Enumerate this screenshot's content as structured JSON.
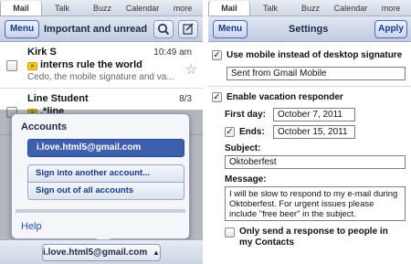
{
  "tabs": [
    "Mail",
    "Talk",
    "Buzz",
    "Calendar",
    "more"
  ],
  "left": {
    "menu_label": "Menu",
    "title": "Important and unread",
    "emails": [
      {
        "from": "Kirk S",
        "date": "10:49 am",
        "subject": "interns rule the world",
        "snippet": "Cedo, the mobile signature and va..."
      },
      {
        "from": "Line Student",
        "date": "8/3",
        "subject": ".*line",
        "snippet": ""
      }
    ],
    "popup": {
      "title": "Accounts",
      "current_account": "i.love.html5@gmail.com",
      "sign_in_other": "Sign into another account...",
      "sign_out_all": "Sign out of all accounts",
      "help": "Help"
    },
    "footer_account": "i.love.html5@gmail.com"
  },
  "right": {
    "menu_label": "Menu",
    "title": "Settings",
    "apply_label": "Apply",
    "use_mobile_signature_label": "Use mobile instead of desktop signature",
    "signature_value": "Sent from Gmail Mobile",
    "vacation_label": "Enable vacation responder",
    "first_day_label": "First day:",
    "first_day_value": "October 7, 2011",
    "ends_label": "Ends:",
    "ends_value": "October 15, 2011",
    "subject_label": "Subject:",
    "subject_value": "Oktoberfest",
    "message_label": "Message:",
    "message_value": "I will be slow to respond to my e-mail during Oktoberfest. For urgent issues please include \"free beer\" in the subject.",
    "contacts_only_label": "Only send a response to people in my Contacts",
    "check_mark": "✓"
  },
  "colors": {
    "accent": "#3e5fae",
    "link": "#2850b4",
    "important": "#f2cc1d"
  },
  "icons": {
    "search": "search-icon",
    "compose": "compose-icon",
    "star": "star-icon",
    "caret": "caret-down-icon"
  }
}
